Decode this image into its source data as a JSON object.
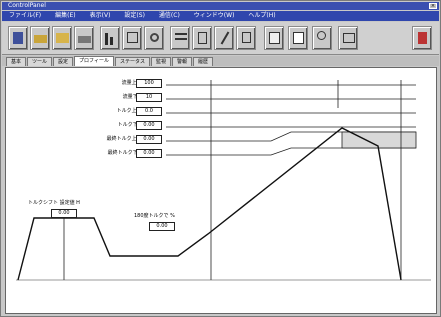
{
  "window": {
    "title": "ControlPanel"
  },
  "menu": [
    "ファイル(F)",
    "編集(E)",
    "表示(V)",
    "設定(S)",
    "通信(C)",
    "ウィンドウ(W)",
    "ヘルプ(H)"
  ],
  "toolbar": [
    "save-icon",
    "open-icon",
    "folder-icon",
    "print-icon",
    "chart-icon",
    "grid-icon",
    "settings-icon",
    "list-icon",
    "copy-icon",
    "pen-icon",
    "warning-icon",
    "doc-icon",
    "edit-icon",
    "magnify-icon",
    "window-icon",
    "exit-icon"
  ],
  "tabs": [
    "基本",
    "ツール",
    "設定",
    "プロフィール",
    "ステータス",
    "監視",
    "警報",
    "履歴"
  ],
  "active_tab": 3,
  "params": [
    {
      "label": "流量上限値 H",
      "value": "100"
    },
    {
      "label": "流量下限値 L",
      "value": "10"
    },
    {
      "label": "トルク上限値 H",
      "value": "0.0"
    },
    {
      "label": "トルク下限値 L",
      "value": "0.00"
    },
    {
      "label": "最終トルク上限値 H",
      "value": "0.00"
    },
    {
      "label": "最終トルク下限値 L",
      "value": "0.00"
    }
  ],
  "snug": {
    "label": "トルクシフト 設定値 H",
    "value": "0.00"
  },
  "cal": {
    "label": "180度トルクで %",
    "value": "0.00"
  },
  "colors": {
    "title": "#3a4fb0",
    "menu": "#2f46ad",
    "window": "#c8c8c8",
    "graph": "#ffffff"
  }
}
